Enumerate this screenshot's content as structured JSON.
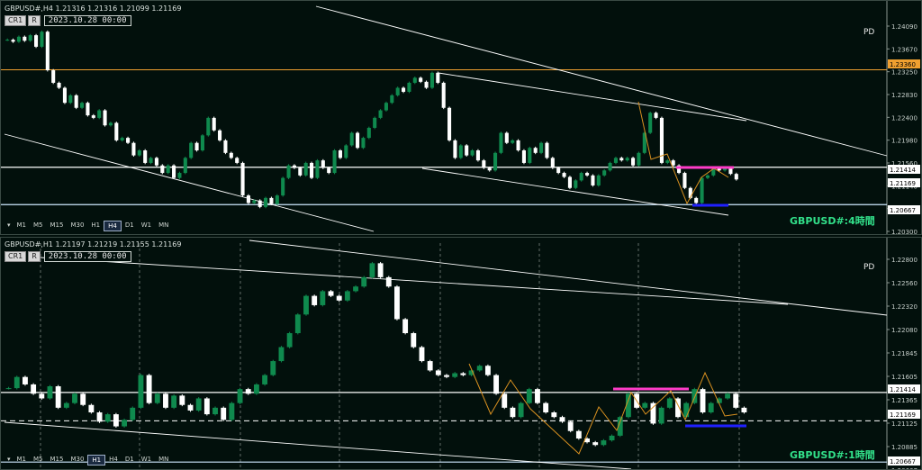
{
  "colors": {
    "bg": "#02100c",
    "up": "#0f8a4e",
    "down": "#ffffff",
    "grid": "#2a3a34",
    "axis_text": "#c8d0cc",
    "trend": "#ffffff",
    "orange": "#f0a030",
    "zigzag": "#d89020",
    "pink": "#ff3cc8",
    "blue": "#2020ff",
    "green_line": "#22c022"
  },
  "panels": [
    {
      "symbol_line": "GBPUSD#,H4  1.21316 1.21316 1.21099 1.21169",
      "cr_label": "CR1",
      "r_label": "R",
      "date_label": "2023.10.28 00:00",
      "pd_label": "PD",
      "title": "GBPUSD#:4時間",
      "timeframes": [
        "M1",
        "M5",
        "M15",
        "M30",
        "H1",
        "H4",
        "D1",
        "W1",
        "MN"
      ],
      "active_tf": "H4",
      "axis_labels": [
        "1.24090",
        "1.23670",
        "1.23250",
        "1.22830",
        "1.22400",
        "1.21980",
        "1.21560",
        "1.21140",
        "1.20720",
        "1.20300"
      ],
      "price_tags": [
        {
          "text": "1.23360",
          "color": "#f0a030"
        },
        {
          "text": "1.21414",
          "color": "#ffffff"
        },
        {
          "text": "1.21169",
          "color": "#ffffff"
        },
        {
          "text": "1.20667",
          "color": "#ffffff"
        }
      ],
      "chart_data": {
        "type": "candlestick",
        "ylim": [
          1.2024,
          1.2434
        ],
        "grid": false,
        "closes": [
          1.2396,
          1.2392,
          1.2402,
          1.2394,
          1.2405,
          1.2382,
          1.2412,
          1.2335,
          1.231,
          1.23,
          1.227,
          1.2285,
          1.226,
          1.227,
          1.2245,
          1.224,
          1.2255,
          1.2225,
          1.223,
          1.2195,
          1.22,
          1.219,
          1.2165,
          1.2175,
          1.215,
          1.216,
          1.2145,
          1.213,
          1.2145,
          1.212,
          1.213,
          1.216,
          1.219,
          1.2175,
          1.2205,
          1.224,
          1.2215,
          1.2195,
          1.217,
          1.216,
          1.215,
          1.2085,
          1.207,
          1.2075,
          1.2062,
          1.208,
          1.2068,
          1.2085,
          1.212,
          1.2145,
          1.214,
          1.2125,
          1.215,
          1.212,
          1.2155,
          1.214,
          1.213,
          1.2175,
          1.216,
          1.2185,
          1.221,
          1.218,
          1.22,
          1.222,
          1.224,
          1.2255,
          1.227,
          1.2285,
          1.23,
          1.2292,
          1.231,
          1.232,
          1.2312,
          1.23,
          1.233,
          1.231,
          1.226,
          1.2195,
          1.216,
          1.2185,
          1.2165,
          1.2175,
          1.2155,
          1.214,
          1.2135,
          1.217,
          1.221,
          1.219,
          1.2195,
          1.2175,
          1.215,
          1.218,
          1.217,
          1.219,
          1.216,
          1.214,
          1.213,
          1.2122,
          1.21,
          1.2115,
          1.213,
          1.2125,
          1.2105,
          1.2125,
          1.2135,
          1.215,
          1.216,
          1.2155,
          1.216,
          1.2145,
          1.217,
          1.221,
          1.225,
          1.224,
          1.215,
          1.2155,
          1.2145,
          1.213,
          1.21,
          1.208,
          1.207,
          1.212,
          1.2125,
          1.214,
          1.2135,
          1.214,
          1.2128,
          1.2117
        ]
      }
    },
    {
      "symbol_line": "GBPUSD#,H1  1.21197 1.21219 1.21155 1.21169",
      "cr_label": "CR1",
      "r_label": "R",
      "date_label": "2023.10.28 00:00",
      "pd_label": "PD",
      "title": "GBPUSD#:1時間",
      "timeframes": [
        "M1",
        "M5",
        "M15",
        "M30",
        "H1",
        "H4",
        "D1",
        "W1",
        "MN"
      ],
      "active_tf": "H1",
      "axis_labels": [
        "1.22800",
        "1.22560",
        "1.22320",
        "1.22080",
        "1.21845",
        "1.21605",
        "1.21365",
        "1.21125",
        "1.20885",
        "1.20667"
      ],
      "price_tags": [
        {
          "text": "1.21414",
          "color": "#ffffff"
        },
        {
          "text": "1.21169",
          "color": "#ffffff"
        },
        {
          "text": "1.20667",
          "color": "#ffffff"
        }
      ],
      "chart_data": {
        "type": "candlestick",
        "ylim": [
          1.2064,
          1.229
        ],
        "grid": "dashed-vertical",
        "closes": [
          1.2146,
          1.2158,
          1.215,
          1.214,
          1.2135,
          1.2148,
          1.2125,
          1.213,
          1.214,
          1.2128,
          1.212,
          1.211,
          1.2118,
          1.2105,
          1.2112,
          1.2125,
          1.216,
          1.213,
          1.214,
          1.2125,
          1.2138,
          1.2128,
          1.2122,
          1.2135,
          1.2118,
          1.2125,
          1.2112,
          1.213,
          1.2145,
          1.214,
          1.215,
          1.216,
          1.2175,
          1.219,
          1.2205,
          1.2225,
          1.2245,
          1.2235,
          1.225,
          1.2245,
          1.224,
          1.225,
          1.2255,
          1.2265,
          1.228,
          1.2265,
          1.2255,
          1.222,
          1.2205,
          1.219,
          1.2175,
          1.2165,
          1.216,
          1.2158,
          1.2162,
          1.216,
          1.2165,
          1.217,
          1.216,
          1.214,
          1.2125,
          1.2115,
          1.213,
          1.2145,
          1.213,
          1.212,
          1.2115,
          1.211,
          1.21,
          1.2092,
          1.2088,
          1.2085,
          1.209,
          1.2095,
          1.2115,
          1.214,
          1.2125,
          1.213,
          1.2108,
          1.2125,
          1.2135,
          1.2115,
          1.213,
          1.2145,
          1.212,
          1.213,
          1.2135,
          1.214,
          1.2125,
          1.212
        ]
      }
    }
  ]
}
